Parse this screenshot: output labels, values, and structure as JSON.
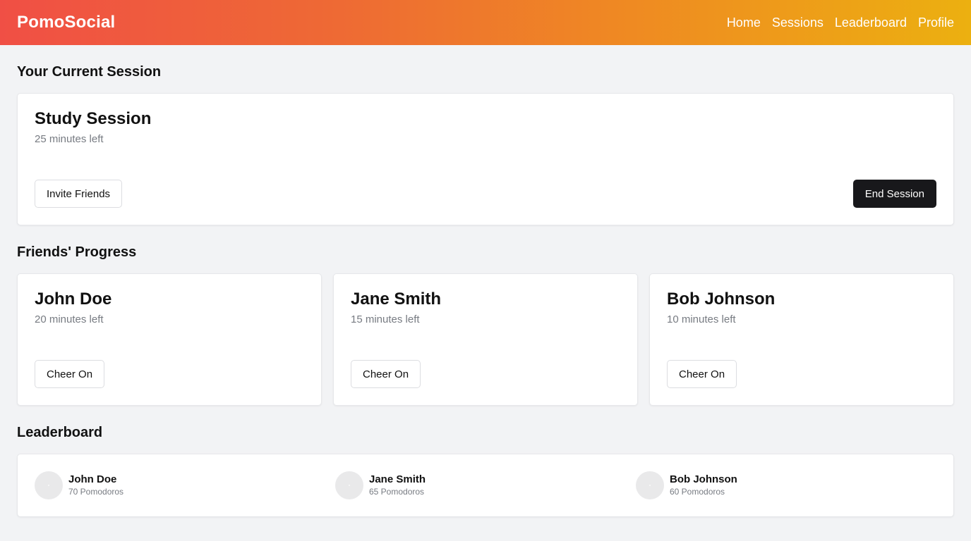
{
  "header": {
    "brand": "PomoSocial",
    "nav": [
      "Home",
      "Sessions",
      "Leaderboard",
      "Profile"
    ]
  },
  "current_session": {
    "heading": "Your Current Session",
    "title": "Study Session",
    "time_left": "25 minutes left",
    "invite_label": "Invite Friends",
    "end_label": "End Session"
  },
  "friends": {
    "heading": "Friends' Progress",
    "cards": [
      {
        "name": "John Doe",
        "time_left": "20 minutes left",
        "action": "Cheer On"
      },
      {
        "name": "Jane Smith",
        "time_left": "15 minutes left",
        "action": "Cheer On"
      },
      {
        "name": "Bob Johnson",
        "time_left": "10 minutes left",
        "action": "Cheer On"
      }
    ]
  },
  "leaderboard": {
    "heading": "Leaderboard",
    "entries": [
      {
        "name": "John Doe",
        "score": "70 Pomodoros"
      },
      {
        "name": "Jane Smith",
        "score": "65 Pomodoros"
      },
      {
        "name": "Bob Johnson",
        "score": "60 Pomodoros"
      }
    ]
  },
  "colors": {
    "gradient_start": "#f04f45",
    "gradient_end": "#ecb010",
    "dark_button": "#18181b",
    "background": "#f2f3f5"
  }
}
